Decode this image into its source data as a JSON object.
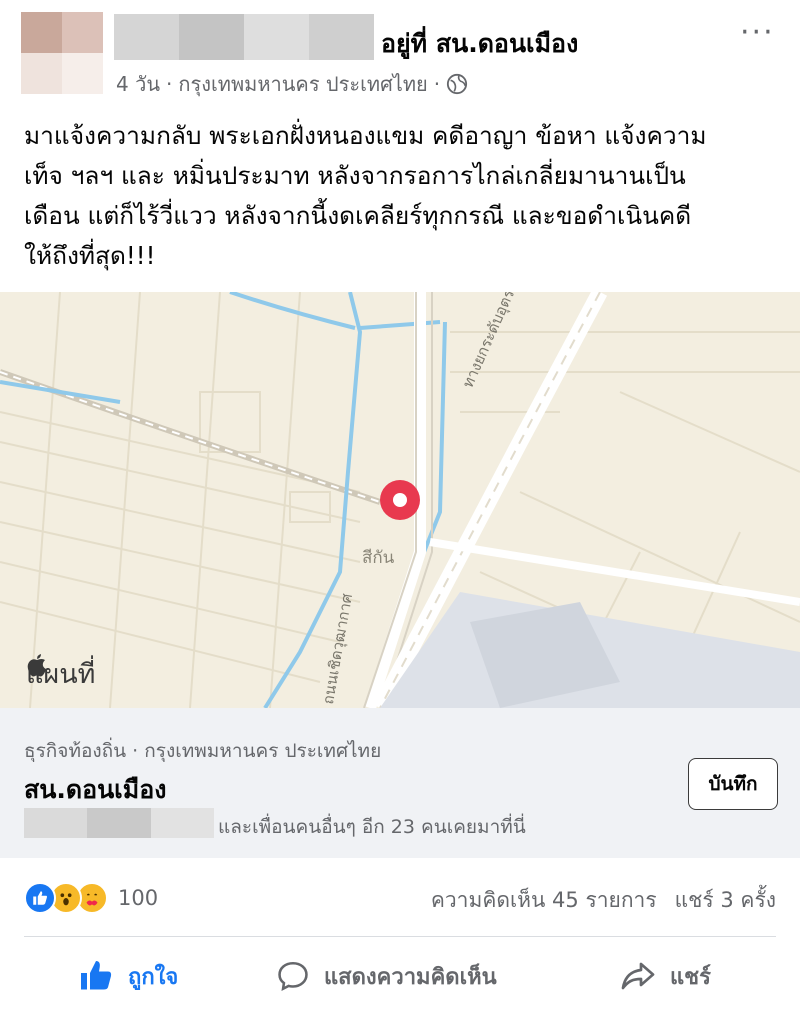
{
  "header": {
    "location_prefix": "อยู่ที่ สน.ดอนเมือง",
    "time": "4 วัน",
    "location": "กรุงเทพมหานคร ประเทศไทย",
    "separator": "·",
    "more_label": "···"
  },
  "post": {
    "lines": [
      "มาแจ้งความกลับ พระเอกฝั่งหนองแขม คดีอาญา ข้อหา แจ้งความ",
      "เท็จ ฯลฯ และ หมิ่นประมาท หลังจากรอการไกล่เกลี่ยมานานเป็น",
      "เดือน แต่ก็ไร้วี่แวว หลังจากนี้งดเคลียร์ทุกกรณี และขอดำเนินคดี",
      "ให้ถึงที่สุด!!!"
    ]
  },
  "map": {
    "provider_label": "แผนที่",
    "area_label": "สีกัน",
    "road_label_1": "ทางยกระดับอุตราภิมุข",
    "road_label_2": "ถนนเชิดวุฒากาศ",
    "pin_color": "#e8394f"
  },
  "place": {
    "category": "ธุรกิจท้องถิ่น · กรุงเทพมหานคร ประเทศไทย",
    "name": "สน.ดอนเมือง",
    "friends_text": "และเพื่อนคนอื่นๆ อีก 23 คนเคยมาที่นี่",
    "save_label": "บันทึก"
  },
  "stats": {
    "reaction_count": "100",
    "comments": "ความคิดเห็น 45 รายการ",
    "shares": "แชร์ 3 ครั้ง"
  },
  "actions": {
    "like": "ถูกใจ",
    "comment": "แสดงความคิดเห็น",
    "share": "แชร์"
  },
  "colors": {
    "accent": "#1877f2",
    "secondary_text": "#65676b",
    "card_bg": "#f0f2f5"
  }
}
